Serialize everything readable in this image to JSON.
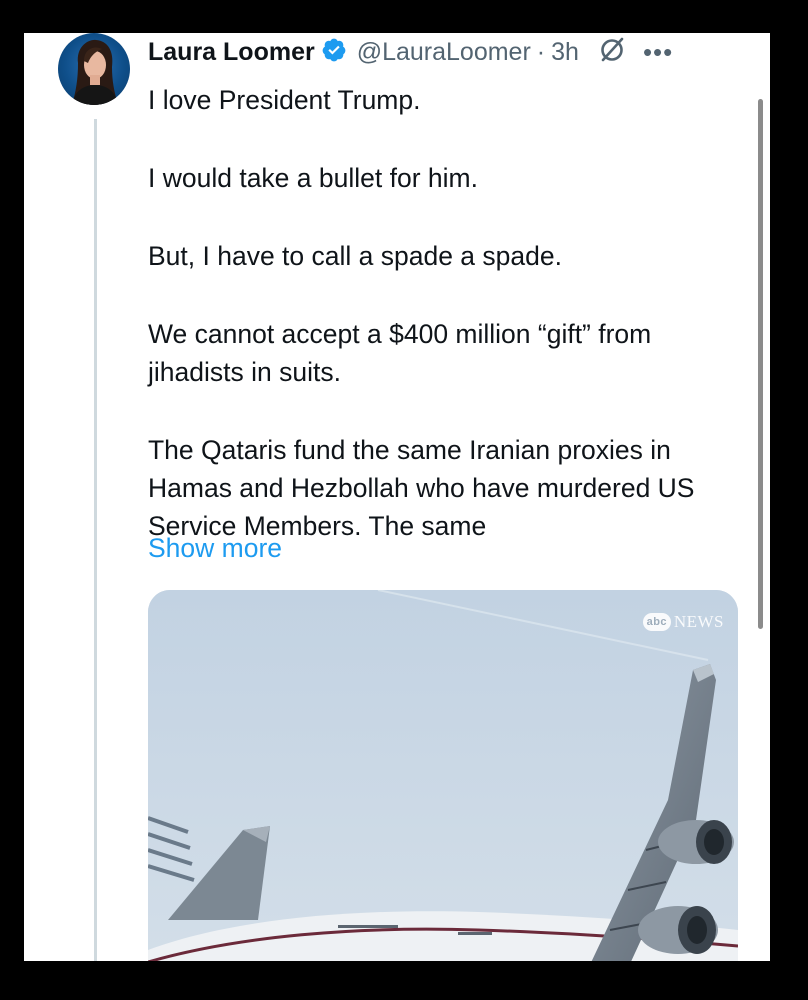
{
  "tweet": {
    "author_name": "Laura Loomer",
    "handle": "@LauraLoomer",
    "separator": "·",
    "time": "3h",
    "paragraphs": [
      "I love President Trump.",
      "I would take a bullet for him.",
      "But, I have to call a spade a spade.",
      "We cannot accept a $400 million “gift” from jihadists in suits.",
      "The Qataris fund the same Iranian proxies in Hamas and Hezbollah who have murdered US Service Members. The same"
    ],
    "show_more_label": "Show more"
  },
  "media": {
    "watermark_logo": "abc",
    "watermark_text": "NEWS"
  },
  "icons": {
    "verified": "verified-badge-icon",
    "grok": "grok-icon",
    "more": "more-options-icon"
  },
  "colors": {
    "link": "#1d9bf0",
    "verified": "#1d9bf0",
    "secondary_text": "#536471",
    "primary_text": "#0f1419",
    "thread_line": "#cfd9de"
  }
}
